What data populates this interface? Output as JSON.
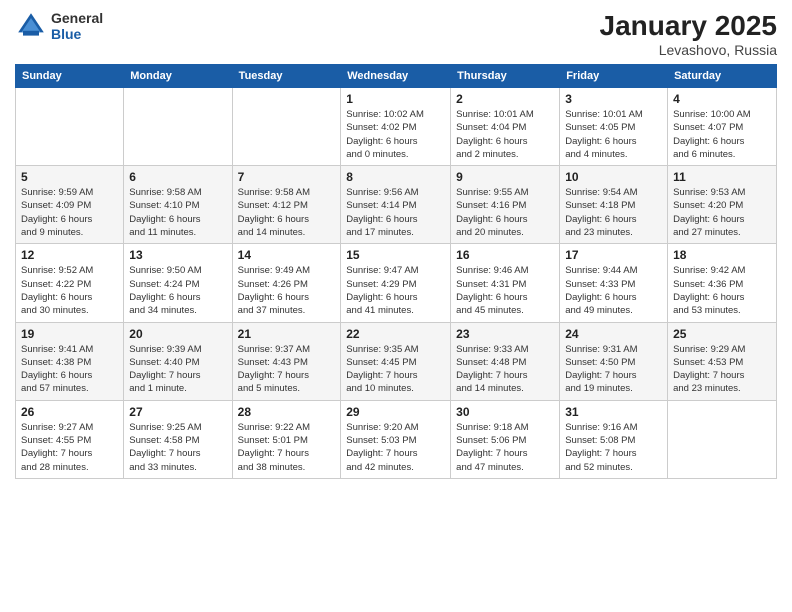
{
  "logo": {
    "general": "General",
    "blue": "Blue"
  },
  "title": "January 2025",
  "location": "Levashovo, Russia",
  "days_of_week": [
    "Sunday",
    "Monday",
    "Tuesday",
    "Wednesday",
    "Thursday",
    "Friday",
    "Saturday"
  ],
  "weeks": [
    [
      {
        "day": "",
        "detail": ""
      },
      {
        "day": "",
        "detail": ""
      },
      {
        "day": "",
        "detail": ""
      },
      {
        "day": "1",
        "detail": "Sunrise: 10:02 AM\nSunset: 4:02 PM\nDaylight: 6 hours\nand 0 minutes."
      },
      {
        "day": "2",
        "detail": "Sunrise: 10:01 AM\nSunset: 4:04 PM\nDaylight: 6 hours\nand 2 minutes."
      },
      {
        "day": "3",
        "detail": "Sunrise: 10:01 AM\nSunset: 4:05 PM\nDaylight: 6 hours\nand 4 minutes."
      },
      {
        "day": "4",
        "detail": "Sunrise: 10:00 AM\nSunset: 4:07 PM\nDaylight: 6 hours\nand 6 minutes."
      }
    ],
    [
      {
        "day": "5",
        "detail": "Sunrise: 9:59 AM\nSunset: 4:09 PM\nDaylight: 6 hours\nand 9 minutes."
      },
      {
        "day": "6",
        "detail": "Sunrise: 9:58 AM\nSunset: 4:10 PM\nDaylight: 6 hours\nand 11 minutes."
      },
      {
        "day": "7",
        "detail": "Sunrise: 9:58 AM\nSunset: 4:12 PM\nDaylight: 6 hours\nand 14 minutes."
      },
      {
        "day": "8",
        "detail": "Sunrise: 9:56 AM\nSunset: 4:14 PM\nDaylight: 6 hours\nand 17 minutes."
      },
      {
        "day": "9",
        "detail": "Sunrise: 9:55 AM\nSunset: 4:16 PM\nDaylight: 6 hours\nand 20 minutes."
      },
      {
        "day": "10",
        "detail": "Sunrise: 9:54 AM\nSunset: 4:18 PM\nDaylight: 6 hours\nand 23 minutes."
      },
      {
        "day": "11",
        "detail": "Sunrise: 9:53 AM\nSunset: 4:20 PM\nDaylight: 6 hours\nand 27 minutes."
      }
    ],
    [
      {
        "day": "12",
        "detail": "Sunrise: 9:52 AM\nSunset: 4:22 PM\nDaylight: 6 hours\nand 30 minutes."
      },
      {
        "day": "13",
        "detail": "Sunrise: 9:50 AM\nSunset: 4:24 PM\nDaylight: 6 hours\nand 34 minutes."
      },
      {
        "day": "14",
        "detail": "Sunrise: 9:49 AM\nSunset: 4:26 PM\nDaylight: 6 hours\nand 37 minutes."
      },
      {
        "day": "15",
        "detail": "Sunrise: 9:47 AM\nSunset: 4:29 PM\nDaylight: 6 hours\nand 41 minutes."
      },
      {
        "day": "16",
        "detail": "Sunrise: 9:46 AM\nSunset: 4:31 PM\nDaylight: 6 hours\nand 45 minutes."
      },
      {
        "day": "17",
        "detail": "Sunrise: 9:44 AM\nSunset: 4:33 PM\nDaylight: 6 hours\nand 49 minutes."
      },
      {
        "day": "18",
        "detail": "Sunrise: 9:42 AM\nSunset: 4:36 PM\nDaylight: 6 hours\nand 53 minutes."
      }
    ],
    [
      {
        "day": "19",
        "detail": "Sunrise: 9:41 AM\nSunset: 4:38 PM\nDaylight: 6 hours\nand 57 minutes."
      },
      {
        "day": "20",
        "detail": "Sunrise: 9:39 AM\nSunset: 4:40 PM\nDaylight: 7 hours\nand 1 minute."
      },
      {
        "day": "21",
        "detail": "Sunrise: 9:37 AM\nSunset: 4:43 PM\nDaylight: 7 hours\nand 5 minutes."
      },
      {
        "day": "22",
        "detail": "Sunrise: 9:35 AM\nSunset: 4:45 PM\nDaylight: 7 hours\nand 10 minutes."
      },
      {
        "day": "23",
        "detail": "Sunrise: 9:33 AM\nSunset: 4:48 PM\nDaylight: 7 hours\nand 14 minutes."
      },
      {
        "day": "24",
        "detail": "Sunrise: 9:31 AM\nSunset: 4:50 PM\nDaylight: 7 hours\nand 19 minutes."
      },
      {
        "day": "25",
        "detail": "Sunrise: 9:29 AM\nSunset: 4:53 PM\nDaylight: 7 hours\nand 23 minutes."
      }
    ],
    [
      {
        "day": "26",
        "detail": "Sunrise: 9:27 AM\nSunset: 4:55 PM\nDaylight: 7 hours\nand 28 minutes."
      },
      {
        "day": "27",
        "detail": "Sunrise: 9:25 AM\nSunset: 4:58 PM\nDaylight: 7 hours\nand 33 minutes."
      },
      {
        "day": "28",
        "detail": "Sunrise: 9:22 AM\nSunset: 5:01 PM\nDaylight: 7 hours\nand 38 minutes."
      },
      {
        "day": "29",
        "detail": "Sunrise: 9:20 AM\nSunset: 5:03 PM\nDaylight: 7 hours\nand 42 minutes."
      },
      {
        "day": "30",
        "detail": "Sunrise: 9:18 AM\nSunset: 5:06 PM\nDaylight: 7 hours\nand 47 minutes."
      },
      {
        "day": "31",
        "detail": "Sunrise: 9:16 AM\nSunset: 5:08 PM\nDaylight: 7 hours\nand 52 minutes."
      },
      {
        "day": "",
        "detail": ""
      }
    ]
  ]
}
